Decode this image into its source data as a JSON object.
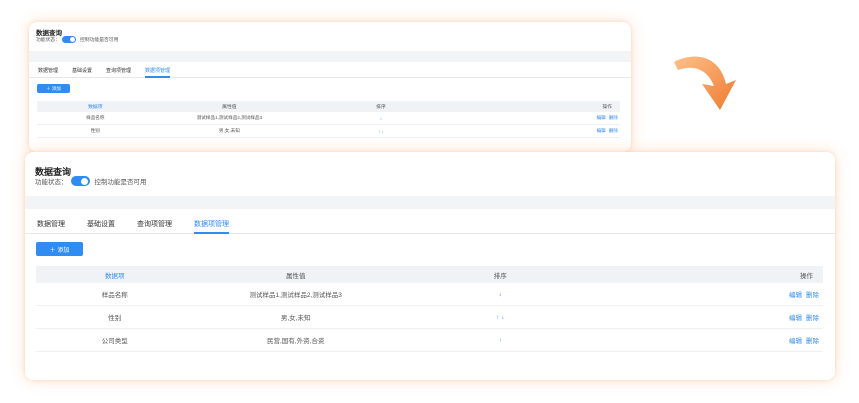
{
  "header": {
    "title": "数据查询",
    "status_label": "功能状态：",
    "status_hint": "控制功能是否可用"
  },
  "tabs": [
    {
      "label": "数据管理",
      "active": false
    },
    {
      "label": "基础设置",
      "active": false
    },
    {
      "label": "查询项管理",
      "active": false
    },
    {
      "label": "数据项管理",
      "active": true
    }
  ],
  "toolbar": {
    "add_label": "＋ 添加"
  },
  "table": {
    "columns": [
      "数据项",
      "属性值",
      "排序",
      "操作"
    ],
    "rows": [
      {
        "name": "样品名称",
        "values": "测试样品1,测试样品2,测试样品3",
        "sort": "↓",
        "edit": "编辑",
        "delete": "删除"
      },
      {
        "name": "性别",
        "values": "男,女,未知",
        "sort": "↑ ↓",
        "edit": "编辑",
        "delete": "删除"
      },
      {
        "name": "公司类型",
        "values": "民营,国有,外资,合资",
        "sort": "↑",
        "edit": "编辑",
        "delete": "删除"
      }
    ]
  },
  "colors": {
    "accent": "#2f8cf0",
    "arrow_start": "#ffb27a",
    "arrow_end": "#f07a2c"
  },
  "icons": {
    "decor_arrow": "curved-arrow-icon",
    "add": "plus-icon",
    "sort_up": "arrow-up-icon",
    "sort_down": "arrow-down-icon"
  }
}
